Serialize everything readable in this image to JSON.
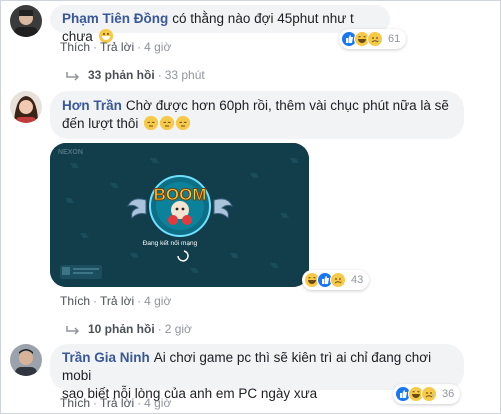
{
  "comments": [
    {
      "author": "Phạm Tiên Đồng",
      "text": "có thằng nào đợi 45phut như t chưa",
      "actions": {
        "like": "Thích",
        "reply": "Trả lời",
        "time": "4 giờ"
      },
      "reaction_count": "61",
      "replies": {
        "label": "33 phản hồi",
        "time": "33 phút"
      }
    },
    {
      "author": "Hơn Trần",
      "text_line1": "Chờ được hơn 60ph rồi, thêm vài chục phút nữa là sẽ",
      "text_line2": "đến lượt thôi",
      "image": {
        "brand": "NEXON",
        "status": "Đang kết nối mạng"
      },
      "actions": {
        "like": "Thích",
        "reply": "Trả lời",
        "time": "4 giờ"
      },
      "reaction_count": "43",
      "replies": {
        "label": "10 phản hồi",
        "time": "2 giờ"
      }
    },
    {
      "author": "Trần Gia Ninh",
      "text_line1": "Ai chơi game pc thì sẽ kiên trì ai chỉ đang chơi mobi",
      "text_line2": "sao biết nỗi lòng của anh em PC ngày xưa",
      "actions": {
        "like": "Thích",
        "reply": "Trả lời",
        "time": "4 giờ"
      },
      "reaction_count": "36"
    }
  ],
  "colors": {
    "name": "#385898",
    "bubble": "#f2f3f5",
    "meta": "#90949c",
    "like": "#1877f2",
    "emoji": "#f7c948"
  }
}
